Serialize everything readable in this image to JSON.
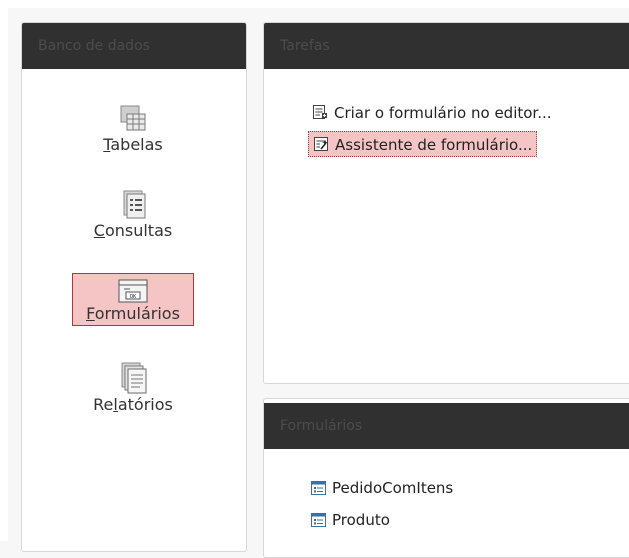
{
  "sidebar": {
    "header": "Banco de dados",
    "items": [
      {
        "pre": "",
        "mnemonic": "T",
        "post": "abelas",
        "icon": "tables-icon",
        "selected": false
      },
      {
        "pre": "",
        "mnemonic": "C",
        "post": "onsultas",
        "icon": "queries-icon",
        "selected": false
      },
      {
        "pre": "",
        "mnemonic": "F",
        "post": "ormulários",
        "icon": "forms-icon",
        "selected": true
      },
      {
        "pre": "Re",
        "mnemonic": "l",
        "post": "atórios",
        "icon": "reports-icon",
        "selected": false
      }
    ]
  },
  "tasks": {
    "header": "Tarefas",
    "items": [
      {
        "label": "Criar o formulário no editor...",
        "icon": "form-editor-icon"
      },
      {
        "label": "Assistente de formulário...",
        "icon": "form-wizard-icon",
        "highlighted": true
      }
    ]
  },
  "forms": {
    "header": "Formulários",
    "items": [
      {
        "label": "PedidoComItens",
        "icon": "form-document-icon"
      },
      {
        "label": "Produto",
        "icon": "form-document-icon"
      }
    ]
  },
  "colors": {
    "header_bg": "#303030",
    "header_text": "#4c4c4c",
    "selection_bg": "#f5c4c4",
    "selection_border": "#a83a3a"
  }
}
